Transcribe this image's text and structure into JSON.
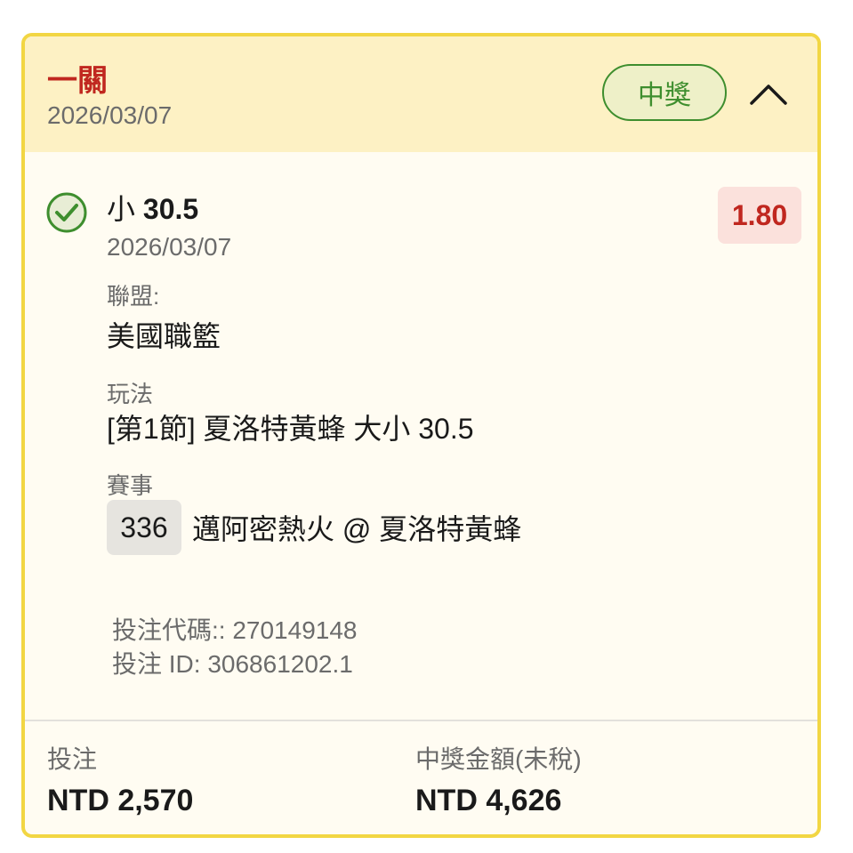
{
  "header": {
    "bet_type": "一關",
    "date": "2026/03/07",
    "status": "中獎"
  },
  "selection": {
    "prefix": "小",
    "line": "30.5",
    "date": "2026/03/07",
    "odds": "1.80"
  },
  "league": {
    "label": "聯盟:",
    "value": "美國職籃"
  },
  "market": {
    "label": "玩法",
    "value": "[第1節] 夏洛特黃蜂 大小 30.5"
  },
  "event": {
    "label": "賽事",
    "number": "336",
    "name": "邁阿密熱火 @ 夏洛特黃蜂"
  },
  "codes": {
    "bet_code": "投注代碼:: 270149148",
    "bet_id": "投注 ID: 306861202.1"
  },
  "footer": {
    "stake_label": "投注",
    "stake_value": "NTD 2,570",
    "payout_label": "中獎金額(未稅)",
    "payout_value": "NTD 4,626"
  },
  "icons": {
    "win": "check-circle-icon",
    "collapse": "chevron-up-icon"
  },
  "colors": {
    "accent_border": "#f2d643",
    "header_bg": "#fdf1c4",
    "win_green": "#3e8e2e",
    "odds_red": "#c0271f"
  }
}
